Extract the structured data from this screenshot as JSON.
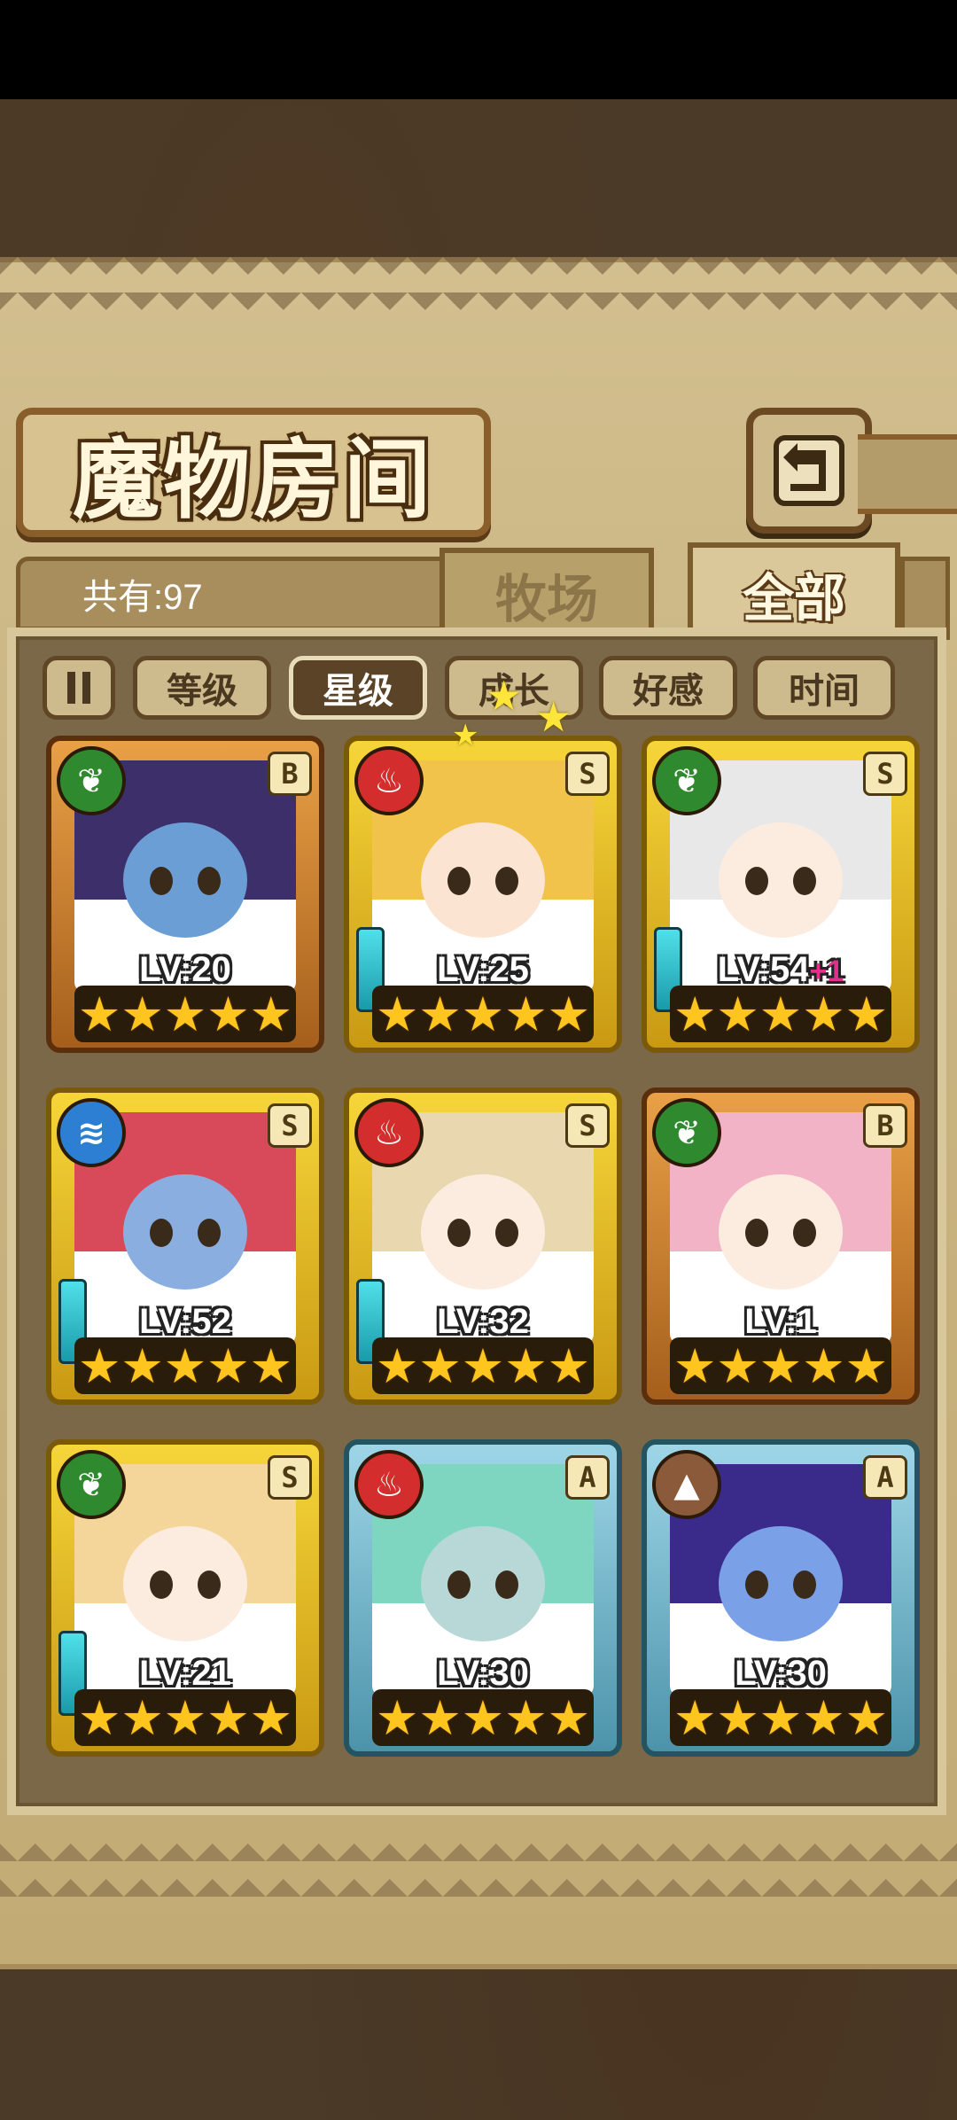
{
  "title": "魔物房间",
  "count_label": "共有:97",
  "tabs": {
    "farm": "牧场",
    "all": "全部"
  },
  "sort": {
    "buttons": [
      "等级",
      "星级",
      "成长",
      "好感",
      "时间"
    ],
    "active": "星级"
  },
  "monsters": [
    {
      "level": "LV:20",
      "bonus": "",
      "rank": "B",
      "element": "leaf",
      "frame": "bronze",
      "stars": "★★★★★",
      "weapon": false,
      "hair": "#3c2f6a",
      "skin": "#6c9ed6"
    },
    {
      "level": "LV:25",
      "bonus": "",
      "rank": "S",
      "element": "fire",
      "frame": "gold",
      "stars": "★★★★★",
      "weapon": true,
      "hair": "#f1c34a",
      "skin": "#fbe4d2"
    },
    {
      "level": "LV:54",
      "bonus": "+1",
      "rank": "S",
      "element": "leaf",
      "frame": "gold",
      "stars": "★★★★★",
      "weapon": true,
      "hair": "#e8e8e8",
      "skin": "#fcece0"
    },
    {
      "level": "LV:52",
      "bonus": "",
      "rank": "S",
      "element": "water",
      "frame": "gold",
      "stars": "★★★★★",
      "weapon": true,
      "hair": "#d84a5a",
      "skin": "#8aaee0"
    },
    {
      "level": "LV:32",
      "bonus": "",
      "rank": "S",
      "element": "fire",
      "frame": "gold",
      "stars": "★★★★★",
      "weapon": true,
      "hair": "#e9d7b0",
      "skin": "#fcece0"
    },
    {
      "level": "LV:1",
      "bonus": "",
      "rank": "B",
      "element": "leaf",
      "frame": "bronze",
      "stars": "★★★★★",
      "weapon": false,
      "hair": "#f2b3c6",
      "skin": "#fcece0"
    },
    {
      "level": "LV:21",
      "bonus": "",
      "rank": "S",
      "element": "leaf",
      "frame": "gold",
      "stars": "★★★★★",
      "weapon": true,
      "hair": "#f4d59a",
      "skin": "#fcece0"
    },
    {
      "level": "LV:30",
      "bonus": "",
      "rank": "A",
      "element": "fire",
      "frame": "blue",
      "stars": "★★★★★",
      "weapon": false,
      "hair": "#7fd6c0",
      "skin": "#b8d8d8"
    },
    {
      "level": "LV:30",
      "bonus": "",
      "rank": "A",
      "element": "earth",
      "frame": "blue",
      "stars": "★★★★★",
      "weapon": false,
      "hair": "#3a2a8a",
      "skin": "#7aa0e8"
    }
  ],
  "element_icons": {
    "leaf": "leaf-icon",
    "fire": "fire-icon",
    "water": "water-icon",
    "earth": "earth-icon"
  }
}
